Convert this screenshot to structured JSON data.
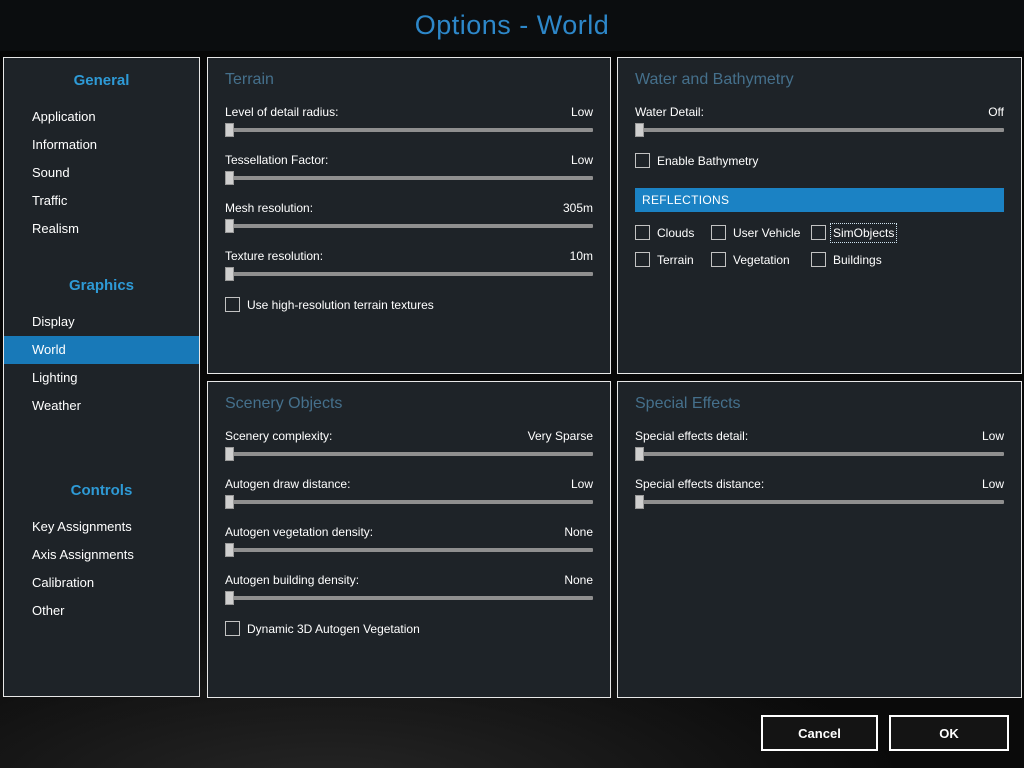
{
  "window": {
    "title": "Options - World"
  },
  "sidebar": {
    "sections": [
      {
        "header": "General",
        "items": [
          "Application",
          "Information",
          "Sound",
          "Traffic",
          "Realism"
        ]
      },
      {
        "header": "Graphics",
        "items": [
          "Display",
          "World",
          "Lighting",
          "Weather"
        ]
      },
      {
        "header": "Controls",
        "items": [
          "Key Assignments",
          "Axis Assignments",
          "Calibration",
          "Other"
        ]
      }
    ],
    "selected_item": "World"
  },
  "panels": {
    "terrain": {
      "title": "Terrain",
      "sliders": [
        {
          "label": "Level of detail radius:",
          "value": "Low",
          "position_pct": 0
        },
        {
          "label": "Tessellation Factor:",
          "value": "Low",
          "position_pct": 0
        },
        {
          "label": "Mesh resolution:",
          "value": "305m",
          "position_pct": 0
        },
        {
          "label": "Texture resolution:",
          "value": "10m",
          "position_pct": 0
        }
      ],
      "checkbox": {
        "label": "Use high-resolution terrain textures",
        "checked": false
      }
    },
    "water": {
      "title": "Water and Bathymetry",
      "sliders": [
        {
          "label": "Water Detail:",
          "value": "Off",
          "position_pct": 0
        }
      ],
      "bathymetry_checkbox": {
        "label": "Enable Bathymetry",
        "checked": false
      },
      "reflections": {
        "header": "REFLECTIONS",
        "options": [
          {
            "label": "Clouds",
            "checked": false,
            "focused": false
          },
          {
            "label": "User Vehicle",
            "checked": false,
            "focused": false
          },
          {
            "label": "SimObjects",
            "checked": false,
            "focused": true
          },
          {
            "label": "Terrain",
            "checked": false,
            "focused": false
          },
          {
            "label": "Vegetation",
            "checked": false,
            "focused": false
          },
          {
            "label": "Buildings",
            "checked": false,
            "focused": false
          }
        ]
      }
    },
    "scenery": {
      "title": "Scenery Objects",
      "sliders": [
        {
          "label": "Scenery complexity:",
          "value": "Very Sparse",
          "position_pct": 0
        },
        {
          "label": "Autogen draw distance:",
          "value": "Low",
          "position_pct": 0
        },
        {
          "label": "Autogen vegetation density:",
          "value": "None",
          "position_pct": 0
        },
        {
          "label": "Autogen building density:",
          "value": "None",
          "position_pct": 0
        }
      ],
      "checkbox": {
        "label": "Dynamic 3D Autogen Vegetation",
        "checked": false
      }
    },
    "effects": {
      "title": "Special Effects",
      "sliders": [
        {
          "label": "Special effects detail:",
          "value": "Low",
          "position_pct": 0
        },
        {
          "label": "Special effects distance:",
          "value": "Low",
          "position_pct": 0
        }
      ]
    }
  },
  "footer": {
    "cancel_label": "Cancel",
    "ok_label": "OK"
  },
  "colors": {
    "accent_title": "#2d87c9",
    "sidebar_header": "#2e9ad6",
    "selected_item_bg": "#1879b8",
    "reflections_bar_bg": "#1b82c4",
    "panel_title": "#45708c"
  }
}
